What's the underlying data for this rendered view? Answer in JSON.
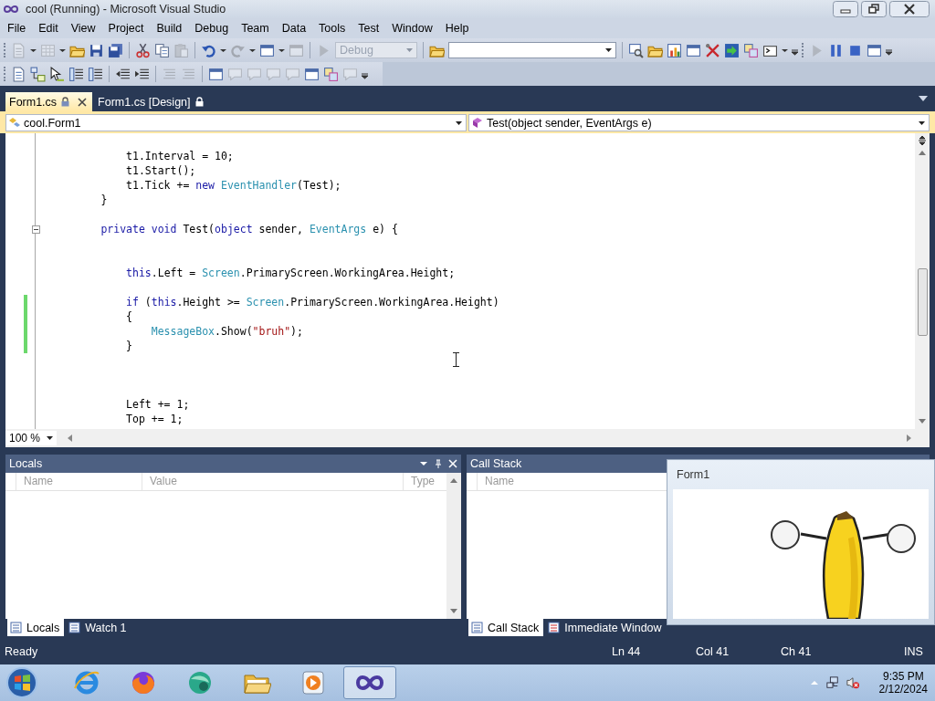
{
  "window": {
    "title": "cool (Running) - Microsoft Visual Studio"
  },
  "menu": [
    "File",
    "Edit",
    "View",
    "Project",
    "Build",
    "Debug",
    "Team",
    "Data",
    "Tools",
    "Test",
    "Window",
    "Help"
  ],
  "toolbar_1": {
    "buttons": [
      {
        "disabled": true
      },
      {
        "disabled": true
      },
      {
        "disabled": false
      },
      {
        "disabled": false
      },
      {
        "disabled": false
      },
      {
        "disabled": false
      },
      {
        "disabled": false
      },
      {
        "disabled": true
      },
      {
        "disabled": false
      },
      {
        "disabled": true
      },
      {
        "disabled": false
      },
      {
        "disabled": true
      },
      {
        "disabled": true
      },
      {
        "disabled": false
      },
      {
        "disabled": false
      },
      {
        "disabled": false
      },
      {
        "disabled": false
      },
      {
        "disabled": false
      },
      {
        "disabled": false
      },
      {
        "disabled": false
      },
      {
        "disabled": false
      },
      {
        "disabled": false
      },
      {
        "disabled": true
      },
      {
        "disabled": false
      },
      {
        "disabled": false
      },
      {
        "disabled": false
      }
    ],
    "configuration": {
      "value": "Debug",
      "disabled": true
    }
  },
  "toolbar_2": {
    "buttons": [
      {
        "disabled": false
      },
      {
        "disabled": false
      },
      {
        "disabled": false
      },
      {
        "disabled": false
      },
      {
        "disabled": false
      },
      {
        "disabled": false
      },
      {
        "disabled": false
      },
      {
        "disabled": true
      },
      {
        "disabled": true
      },
      {
        "disabled": false
      },
      {
        "disabled": true
      },
      {
        "disabled": true
      },
      {
        "disabled": true
      },
      {
        "disabled": true
      },
      {
        "disabled": false
      },
      {
        "disabled": false
      },
      {
        "disabled": true
      }
    ]
  },
  "document_tabs": [
    {
      "label": "Form1.cs",
      "selected": true,
      "locked": true
    },
    {
      "label": "Form1.cs [Design]",
      "selected": false,
      "locked": true
    }
  ],
  "navigation": {
    "type": "cool.Form1",
    "member": "Test(object sender, EventArgs e)"
  },
  "editor": {
    "zoom": "100 %",
    "lines": [
      {
        "changed": false,
        "foldable": false,
        "tokens": [
          {
            "kind": "text",
            "text": "            t1.Interval = 10;"
          }
        ]
      },
      {
        "changed": false,
        "foldable": false,
        "tokens": [
          {
            "kind": "text",
            "text": "            t1.Start();"
          }
        ]
      },
      {
        "changed": false,
        "foldable": false,
        "tokens": [
          {
            "kind": "text",
            "text": "            t1.Tick += "
          },
          {
            "kind": "keyword",
            "text": "new "
          },
          {
            "kind": "type",
            "text": "EventHandler"
          },
          {
            "kind": "text",
            "text": "(Test);"
          }
        ]
      },
      {
        "changed": false,
        "foldable": false,
        "tokens": [
          {
            "kind": "text",
            "text": "        }"
          }
        ]
      },
      {
        "changed": false,
        "foldable": false
      },
      {
        "changed": false,
        "foldable": true,
        "tokens": [
          {
            "kind": "keyword",
            "text": "        private void"
          },
          {
            "kind": "text",
            "text": " Test("
          },
          {
            "kind": "keyword",
            "text": "object"
          },
          {
            "kind": "text",
            "text": " sender, "
          },
          {
            "kind": "type",
            "text": "EventArgs"
          },
          {
            "kind": "text",
            "text": " e) {"
          }
        ]
      },
      {
        "changed": false,
        "foldable": false
      },
      {
        "changed": false,
        "foldable": false
      },
      {
        "changed": false,
        "foldable": false,
        "tokens": [
          {
            "kind": "keyword",
            "text": "            this"
          },
          {
            "kind": "text",
            "text": ".Left = "
          },
          {
            "kind": "type",
            "text": "Screen"
          },
          {
            "kind": "text",
            "text": ".PrimaryScreen.WorkingArea.Height;"
          }
        ]
      },
      {
        "changed": false,
        "foldable": false
      },
      {
        "changed": true,
        "foldable": false,
        "tokens": [
          {
            "kind": "keyword",
            "text": "            if"
          },
          {
            "kind": "text",
            "text": " ("
          },
          {
            "kind": "keyword",
            "text": "this"
          },
          {
            "kind": "text",
            "text": ".Height >= "
          },
          {
            "kind": "type",
            "text": "Screen"
          },
          {
            "kind": "text",
            "text": ".PrimaryScreen.WorkingArea.Height)"
          }
        ]
      },
      {
        "changed": true,
        "foldable": false,
        "tokens": [
          {
            "kind": "text",
            "text": "            {"
          }
        ]
      },
      {
        "changed": true,
        "foldable": false,
        "tokens": [
          {
            "kind": "type",
            "text": "                MessageBox"
          },
          {
            "kind": "text",
            "text": ".Show("
          },
          {
            "kind": "string",
            "text": "\"bruh\""
          },
          {
            "kind": "text",
            "text": ");"
          }
        ]
      },
      {
        "changed": true,
        "foldable": false,
        "tokens": [
          {
            "kind": "text",
            "text": "            }"
          }
        ]
      },
      {
        "changed": false,
        "foldable": false
      },
      {
        "changed": false,
        "foldable": false
      },
      {
        "changed": false,
        "foldable": false
      },
      {
        "changed": false,
        "foldable": false,
        "tokens": [
          {
            "kind": "text",
            "text": "            Left += 1;"
          }
        ]
      },
      {
        "changed": false,
        "foldable": false,
        "tokens": [
          {
            "kind": "text",
            "text": "            Top += 1;"
          }
        ]
      }
    ]
  },
  "locals_panel": {
    "title": "Locals",
    "columns": [
      "Name",
      "Value",
      "Type"
    ],
    "tabs": [
      {
        "label": "Locals",
        "selected": true
      },
      {
        "label": "Watch 1",
        "selected": false
      }
    ]
  },
  "call_stack_panel": {
    "title": "Call Stack",
    "columns": [
      "Name"
    ],
    "tabs": [
      {
        "label": "Call Stack",
        "selected": true
      },
      {
        "label": "Immediate Window",
        "selected": false
      }
    ]
  },
  "form_window": {
    "title": "Form1"
  },
  "status_bar": {
    "message": "Ready",
    "line": "Ln 44",
    "column": "Col 41",
    "character": "Ch 41",
    "mode": "INS"
  },
  "taskbar": {
    "apps": [
      {
        "selected": false
      },
      {
        "selected": false
      },
      {
        "selected": false
      },
      {
        "selected": false
      },
      {
        "selected": false
      },
      {
        "selected": true
      }
    ],
    "time": "9:35 PM",
    "date": "2/12/2024"
  }
}
